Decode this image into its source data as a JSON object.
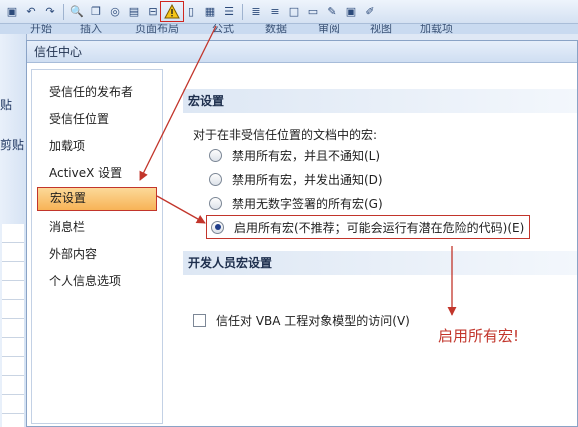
{
  "ribbon": {
    "tabs": [
      "开始",
      "插入",
      "页面布局",
      "公式",
      "数据",
      "审阅",
      "视图",
      "加载项"
    ],
    "left_fragments": [
      "贴",
      "剪贴"
    ]
  },
  "toolbar": {
    "icons": [
      "save-icon",
      "undo-icon",
      "redo-icon",
      "print-preview-icon",
      "copy-icon",
      "paste-icon",
      "form-icon",
      "link-icon",
      "warning-icon",
      "document-icon",
      "table-icon",
      "list-icon",
      "paragraph-icon",
      "align-icon",
      "new-doc-icon",
      "page-setup-icon",
      "tools-icon",
      "screen-icon",
      "edit-icon"
    ]
  },
  "dialog": {
    "title": "信任中心",
    "nav_items": [
      {
        "label": "受信任的发布者",
        "selected": false
      },
      {
        "label": "受信任位置",
        "selected": false
      },
      {
        "label": "加载项",
        "selected": false
      },
      {
        "label": "ActiveX 设置",
        "selected": false
      },
      {
        "label": "宏设置",
        "selected": true
      },
      {
        "label": "消息栏",
        "selected": false
      },
      {
        "label": "外部内容",
        "selected": false
      },
      {
        "label": "个人信息选项",
        "selected": false
      }
    ],
    "macro_section": {
      "header": "宏设置",
      "question": "对于在非受信任位置的文档中的宏:",
      "options": [
        {
          "label": "禁用所有宏，并且不通知(L)",
          "checked": false
        },
        {
          "label": "禁用所有宏，并发出通知(D)",
          "checked": false
        },
        {
          "label": "禁用无数字签署的所有宏(G)",
          "checked": false
        },
        {
          "label": "启用所有宏(不推荐；可能会运行有潜在危险的代码)(E)",
          "checked": true
        }
      ]
    },
    "developer_section": {
      "header": "开发人员宏设置",
      "checkbox_label": "信任对 VBA 工程对象模型的访问(V)",
      "checked": false
    }
  },
  "annotation": {
    "text": "启用所有宏!",
    "color": "#c2352b"
  }
}
